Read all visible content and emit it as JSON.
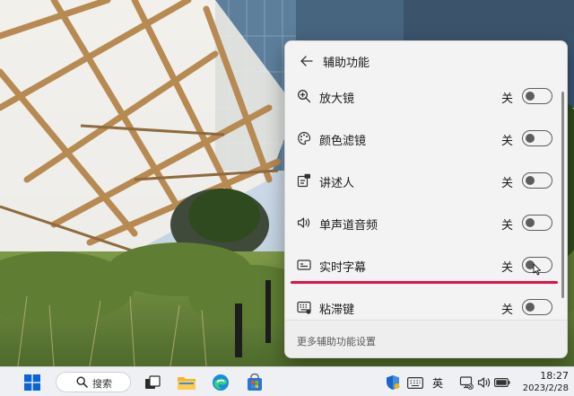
{
  "panel": {
    "title": "辅助功能",
    "items": [
      {
        "label": "放大镜",
        "state": "关",
        "icon": "magnifier-icon",
        "enabled": false
      },
      {
        "label": "颜色滤镜",
        "state": "关",
        "icon": "palette-icon",
        "enabled": false
      },
      {
        "label": "讲述人",
        "state": "关",
        "icon": "narrator-icon",
        "enabled": false
      },
      {
        "label": "单声道音频",
        "state": "关",
        "icon": "mono-audio-icon",
        "enabled": false
      },
      {
        "label": "实时字幕",
        "state": "关",
        "icon": "captions-icon",
        "enabled": false
      },
      {
        "label": "粘滞键",
        "state": "关",
        "icon": "sticky-keys-icon",
        "enabled": false
      }
    ],
    "footer_link": "更多辅助功能设置"
  },
  "taskbar": {
    "search_label": "搜索",
    "ime_label": "英",
    "time": "18:27",
    "date": "2023/2/28"
  },
  "colors": {
    "highlight": "#e4104a",
    "panel_bg": "#f3f3f3",
    "windows_blue": "#0a64d8"
  }
}
